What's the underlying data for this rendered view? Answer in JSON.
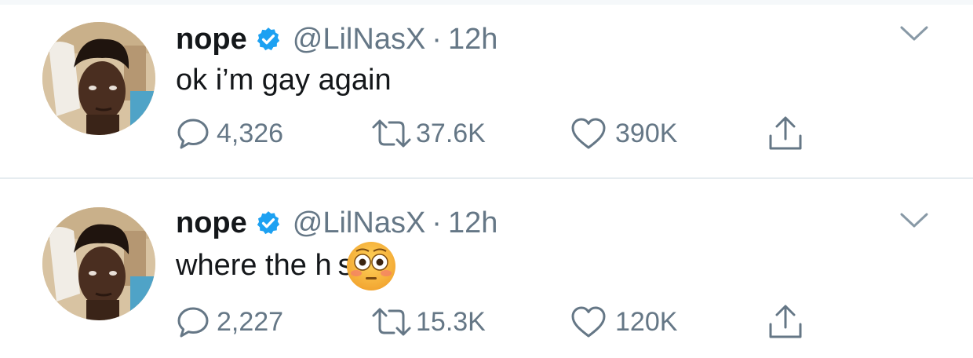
{
  "tweets": [
    {
      "name": "nope",
      "handle": "@LilNasX",
      "separator": "·",
      "time": "12h",
      "text": "ok i’m gay again",
      "replies": "4,326",
      "retweets": "37.6K",
      "likes": "390K"
    },
    {
      "name": "nope",
      "handle": "@LilNasX",
      "separator": "·",
      "time": "12h",
      "text": "where the h",
      "text_after": "s at",
      "emoji": "flushed-face",
      "replies": "2,227",
      "retweets": "15.3K",
      "likes": "120K"
    }
  ],
  "colors": {
    "text": "#14171a",
    "secondary": "#657786",
    "verified": "#1da1f2",
    "divider": "#e6ecf0"
  },
  "icons": {
    "reply": "reply-icon",
    "retweet": "retweet-icon",
    "like": "heart-icon",
    "share": "share-icon",
    "menu": "chevron-down-icon",
    "verified": "verified-badge-icon"
  }
}
